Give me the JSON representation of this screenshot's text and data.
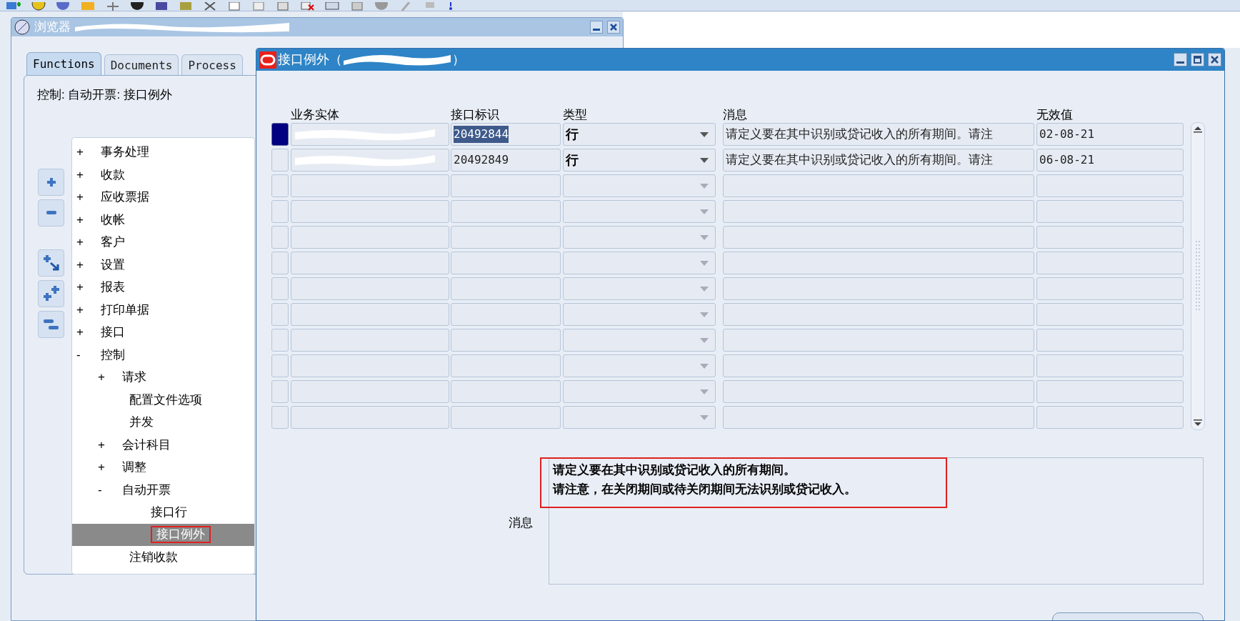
{
  "navigator": {
    "title": "浏览器",
    "tabs": [
      {
        "label": "Functions",
        "selected": true
      },
      {
        "label": "Documents",
        "selected": false
      },
      {
        "label": "Process",
        "selected": false
      }
    ],
    "path": "控制: 自动开票: 接口例外",
    "tree": [
      {
        "label": "事务处理",
        "toggle": "+",
        "selected": false
      },
      {
        "label": "收款",
        "toggle": "+",
        "selected": false
      },
      {
        "label": "应收票据",
        "toggle": "+",
        "selected": false
      },
      {
        "label": "收帐",
        "toggle": "+",
        "selected": false
      },
      {
        "label": "客户",
        "toggle": "+",
        "selected": false
      },
      {
        "label": "设置",
        "toggle": "+",
        "selected": false
      },
      {
        "label": "报表",
        "toggle": "+",
        "selected": false
      },
      {
        "label": "打印单据",
        "toggle": "+",
        "selected": false
      },
      {
        "label": "接口",
        "toggle": "+",
        "selected": false
      },
      {
        "label": "控制",
        "toggle": "-",
        "selected": false,
        "children": [
          {
            "label": "请求",
            "toggle": "+",
            "selected": false
          },
          {
            "label": "配置文件选项",
            "selected": false
          },
          {
            "label": "并发",
            "selected": false
          },
          {
            "label": "会计科目",
            "toggle": "+",
            "selected": false
          },
          {
            "label": "调整",
            "toggle": "+",
            "selected": false
          },
          {
            "label": "自动开票",
            "toggle": "-",
            "selected": false,
            "children": [
              {
                "label": "接口行",
                "selected": false
              },
              {
                "label": "接口例外",
                "selected": true
              }
            ]
          },
          {
            "label": "注销收款",
            "selected": false
          }
        ]
      }
    ]
  },
  "exceptions_window": {
    "title": "接口例外（",
    "title_end": "）",
    "columns": [
      "业务实体",
      "接口标识",
      "类型",
      "消息",
      "无效值"
    ],
    "rows": [
      {
        "selected": true,
        "interface_id": "20492844",
        "type": "行",
        "message": "请定义要在其中识别或贷记收入的所有期间。请注",
        "invalid_value": "02-08-21"
      },
      {
        "selected": false,
        "interface_id": "20492849",
        "type": "行",
        "message": "请定义要在其中识别或贷记收入的所有期间。请注",
        "invalid_value": "06-08-21"
      }
    ],
    "message_detail": {
      "label": "消息",
      "lines": [
        "请定义要在其中识别或贷记收入的所有期间。",
        "请注意，在关闭期间或待关闭期间无法识别或贷记收入。"
      ]
    }
  }
}
